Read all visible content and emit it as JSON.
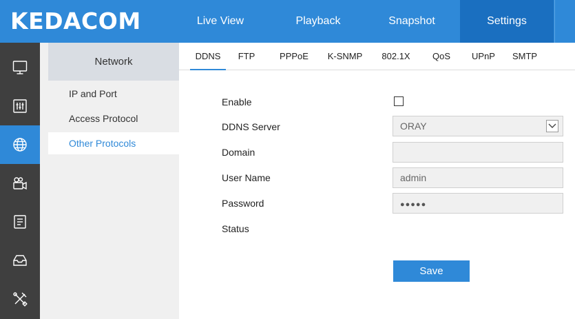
{
  "app": {
    "logo": "KEDACOM"
  },
  "topnav": {
    "items": [
      {
        "label": "Live View"
      },
      {
        "label": "Playback"
      },
      {
        "label": "Snapshot"
      },
      {
        "label": "Settings",
        "active": true
      }
    ]
  },
  "rail": {
    "items": [
      {
        "icon": "monitor-icon"
      },
      {
        "icon": "sliders-icon"
      },
      {
        "icon": "globe-icon",
        "active": true
      },
      {
        "icon": "camera-icon"
      },
      {
        "icon": "document-icon"
      },
      {
        "icon": "inbox-icon"
      },
      {
        "icon": "tools-icon"
      }
    ]
  },
  "submenu": {
    "header": "Network",
    "items": [
      {
        "label": "IP and Port"
      },
      {
        "label": "Access Protocol"
      },
      {
        "label": "Other Protocols",
        "active": true
      }
    ]
  },
  "tabs": [
    {
      "label": "DDNS",
      "active": true
    },
    {
      "label": "FTP"
    },
    {
      "label": "PPPoE"
    },
    {
      "label": "K-SNMP"
    },
    {
      "label": "802.1X"
    },
    {
      "label": "QoS"
    },
    {
      "label": "UPnP"
    },
    {
      "label": "SMTP"
    }
  ],
  "form": {
    "enable": {
      "label": "Enable",
      "checked": false
    },
    "ddns_server": {
      "label": "DDNS Server",
      "value": "ORAY"
    },
    "domain": {
      "label": "Domain",
      "value": ""
    },
    "user_name": {
      "label": "User Name",
      "value": "admin"
    },
    "password": {
      "label": "Password",
      "value": "●●●●●"
    },
    "status": {
      "label": "Status",
      "value": ""
    },
    "save_label": "Save"
  },
  "colors": {
    "accent": "#2f89d8",
    "topbar": "#2f89d8",
    "active_nav": "#1a6fc0",
    "rail": "#3f3f3f",
    "submenu_bg": "#f0f0f0",
    "submenu_header": "#d9dde3"
  }
}
